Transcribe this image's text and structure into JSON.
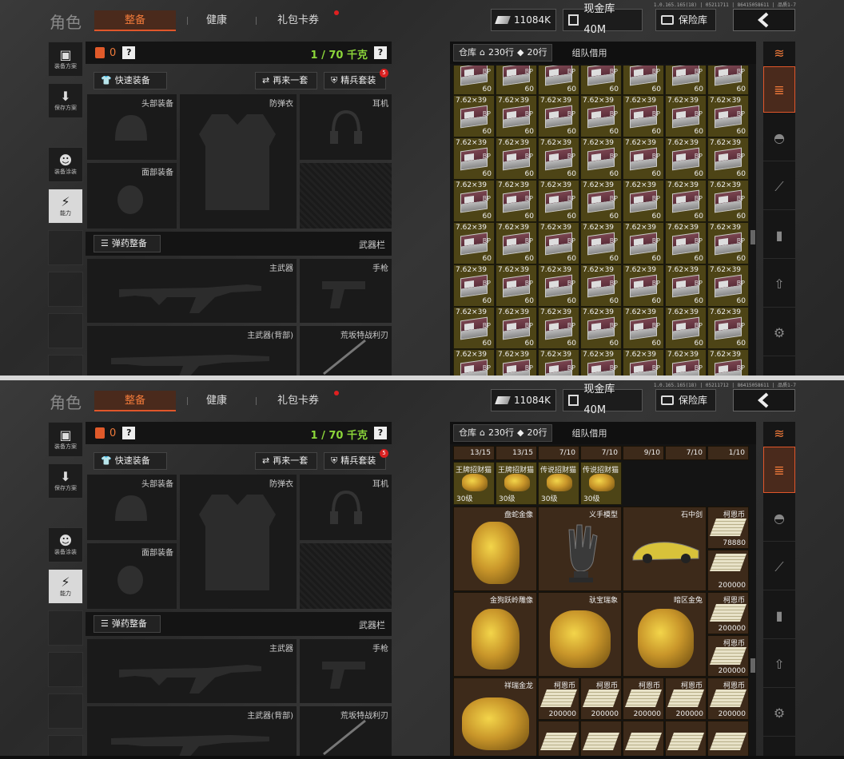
{
  "top": {
    "version": "1.0.165.165(18) | 05211711 | 86415058611 | 品质1-7",
    "stash_view": "ammo"
  },
  "bottom": {
    "version": "1.0.165.165(18) | 05211712 | 86415058611 | 品质1-7",
    "stash_view": "valuables"
  },
  "header": {
    "role": "角色",
    "tabs": [
      "整备",
      "健康",
      "礼包卡券"
    ],
    "money": "11084K",
    "cash_vault": "现金库 40M",
    "safe_vault": "保险库"
  },
  "sidebar": {
    "items": [
      "装备方案",
      "保存方案",
      "装备涂装",
      "能力"
    ]
  },
  "equip": {
    "armor_count": "0",
    "weight": "1 / 70 千克",
    "quick_equip": "快速装备",
    "again": "再来一套",
    "elite": "精兵套装",
    "elite_badge": "5",
    "slots": {
      "head": "头部装备",
      "vest": "防弹衣",
      "ear": "耳机",
      "face": "面部装备",
      "ammo_btn": "弹药整备",
      "weapon_bar": "武器栏",
      "primary": "主武器",
      "pistol": "手枪",
      "primary_back": "主武器(背部)",
      "melee": "荒坂特战利刃"
    }
  },
  "stash": {
    "tab_label": "仓库",
    "rows_a": "230行",
    "rows_b": "20行",
    "team_borrow": "组队借用"
  },
  "ammo": {
    "name": "7.62×39",
    "sub": "BP",
    "count": "60"
  },
  "valuables": {
    "top_counts": [
      "13/15",
      "13/15",
      "7/10",
      "7/10",
      "9/10",
      "7/10",
      "1/10"
    ],
    "level_items": [
      {
        "name": "王牌招财猫",
        "level": "30级"
      },
      {
        "name": "王牌招财猫",
        "level": "30级"
      },
      {
        "name": "传说招财猫",
        "level": "30级"
      },
      {
        "name": "传说招财猫",
        "level": "30级"
      }
    ],
    "statues": [
      "盘蛇金像",
      "义手模型",
      "石中剑",
      "金狗跃岭雕像",
      "驮宝瑞象",
      "暗区金兔",
      "祥瑞金龙"
    ],
    "coin_name": "柯恩币",
    "coin_amounts": [
      "78880",
      "200000"
    ]
  },
  "rail": {
    "icons": [
      "stash-icon",
      "helmet-icon",
      "rifle-icon",
      "magazine-icon",
      "bullet-icon",
      "gear-icon"
    ]
  }
}
